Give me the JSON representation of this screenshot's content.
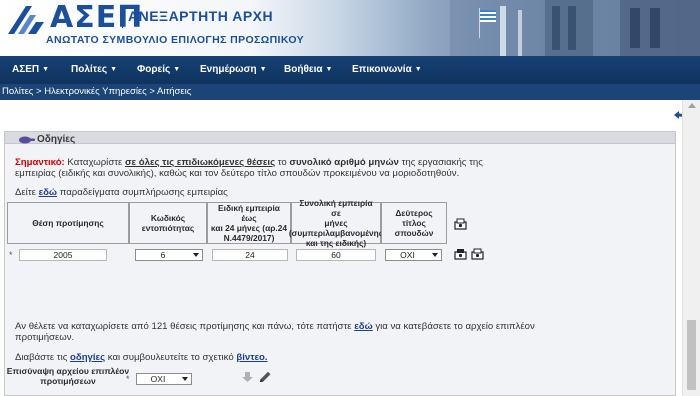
{
  "header": {
    "logo_title": "ΑΣΕΠ",
    "logo_independent": "ΑΝΕΞΑΡΤΗΤΗ ΑΡΧΗ",
    "logo_subtitle": "ΑΝΩΤΑΤΟ ΣΥΜΒΟΥΛΙΟ ΕΠΙΛΟΓΗΣ ΠΡΟΣΩΠΙΚΟΥ"
  },
  "nav": {
    "items": [
      {
        "label": "ΑΣΕΠ"
      },
      {
        "label": "Πολίτες"
      },
      {
        "label": "Φορείς"
      },
      {
        "label": "Ενημέρωση"
      },
      {
        "label": "Βοήθεια"
      },
      {
        "label": "Επικοινωνία"
      }
    ],
    "caret": "▼"
  },
  "breadcrumb": "Πολίτες > Ηλεκτρονικές Υπηρεσίες > Αιτήσεις",
  "panel": {
    "title": "Οδηγίες",
    "important_label": "Σημαντικό:",
    "text_1": " Καταχωρίστε ",
    "text_2": "σε όλες τις επιδιωκόμενες θέσεις",
    "text_3": " το ",
    "text_4": "συνολικό αριθμό μηνών",
    "text_5": " της εργασιακής της",
    "line_2": "εμπειρίας (ειδικής και συνολικής), καθώς και τον δεύτερο τίτλο σπουδών προκειμένου να μοριοδοτηθούν.",
    "examples_pre": "Δείτε ",
    "examples_link": "εδώ",
    "examples_post": " παραδείγματα συμπλήρωσης εμπειρίας"
  },
  "table": {
    "headers": [
      [
        "Θέση προτίμησης"
      ],
      [
        "Κωδικός",
        "εντοπιότητας"
      ],
      [
        "Ειδική εμπειρία έως",
        "και 24 μήνες (αρ.24",
        "Ν.4479/2017)"
      ],
      [
        "Συνολική εμπειρία σε",
        "μήνες",
        "(συμπεριλαμβανομένης",
        "και της ειδικής)"
      ],
      [
        "Δεύτερος τίτλος",
        "σπουδών"
      ]
    ],
    "row": {
      "required_mark": "*",
      "position": "2005",
      "locality_code": "6",
      "special_experience": "24",
      "total_experience": "60",
      "second_degree": "ΟΧΙ"
    }
  },
  "footer": {
    "line_1_pre": "Αν θέλετε να καταχωρίσετε από 121 θέσεις προτίμησης και πάνω, τότε πατήστε ",
    "line_1_link": "εδώ",
    "line_1_post": " για να κατεβάσετε το αρχείο επιπλέον",
    "line_2": "προτιμήσεων.",
    "line_3_pre": "Διαβάστε τις ",
    "line_3_link1": "οδηγίες",
    "line_3_mid": " και συμβουλευτείτε το σχετικό ",
    "line_3_link2": "βίντεο.",
    "attach_label_1": "Επισύναψη αρχείου επιπλέον",
    "attach_label_2": "προτιμήσεων",
    "attach_required": "*",
    "attach_value": "ΟΧΙ"
  },
  "colors": {
    "nav_bg": "#174174",
    "brand_blue": "#1b4f9c",
    "important_red": "#d60000",
    "link_blue": "#1b3f8f"
  }
}
